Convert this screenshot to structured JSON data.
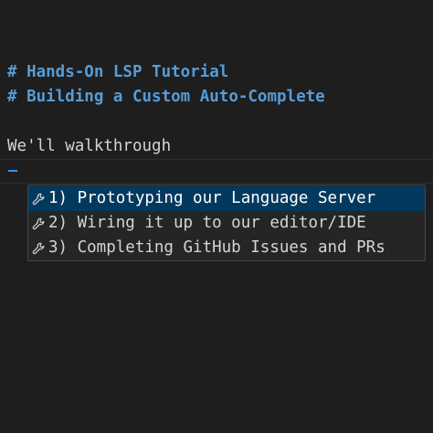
{
  "editor": {
    "lines": {
      "heading1": "# Hands-On LSP Tutorial",
      "heading2": "# Building a Custom Auto-Complete",
      "text": "We'll walkthrough"
    }
  },
  "suggestions": {
    "items": [
      {
        "label": "1) Prototyping our Language Server",
        "icon": "wrench-icon",
        "selected": true
      },
      {
        "label": "2) Wiring it up to our editor/IDE",
        "icon": "wrench-icon",
        "selected": false
      },
      {
        "label": "3) Completing GitHub Issues and PRs",
        "icon": "wrench-icon",
        "selected": false
      }
    ]
  },
  "colors": {
    "background": "#1e1e1e",
    "heading": "#569cd6",
    "text": "#d4d4d4",
    "cursor": "#3794ff",
    "suggest_background": "#252526",
    "suggest_selected": "#04395e"
  }
}
